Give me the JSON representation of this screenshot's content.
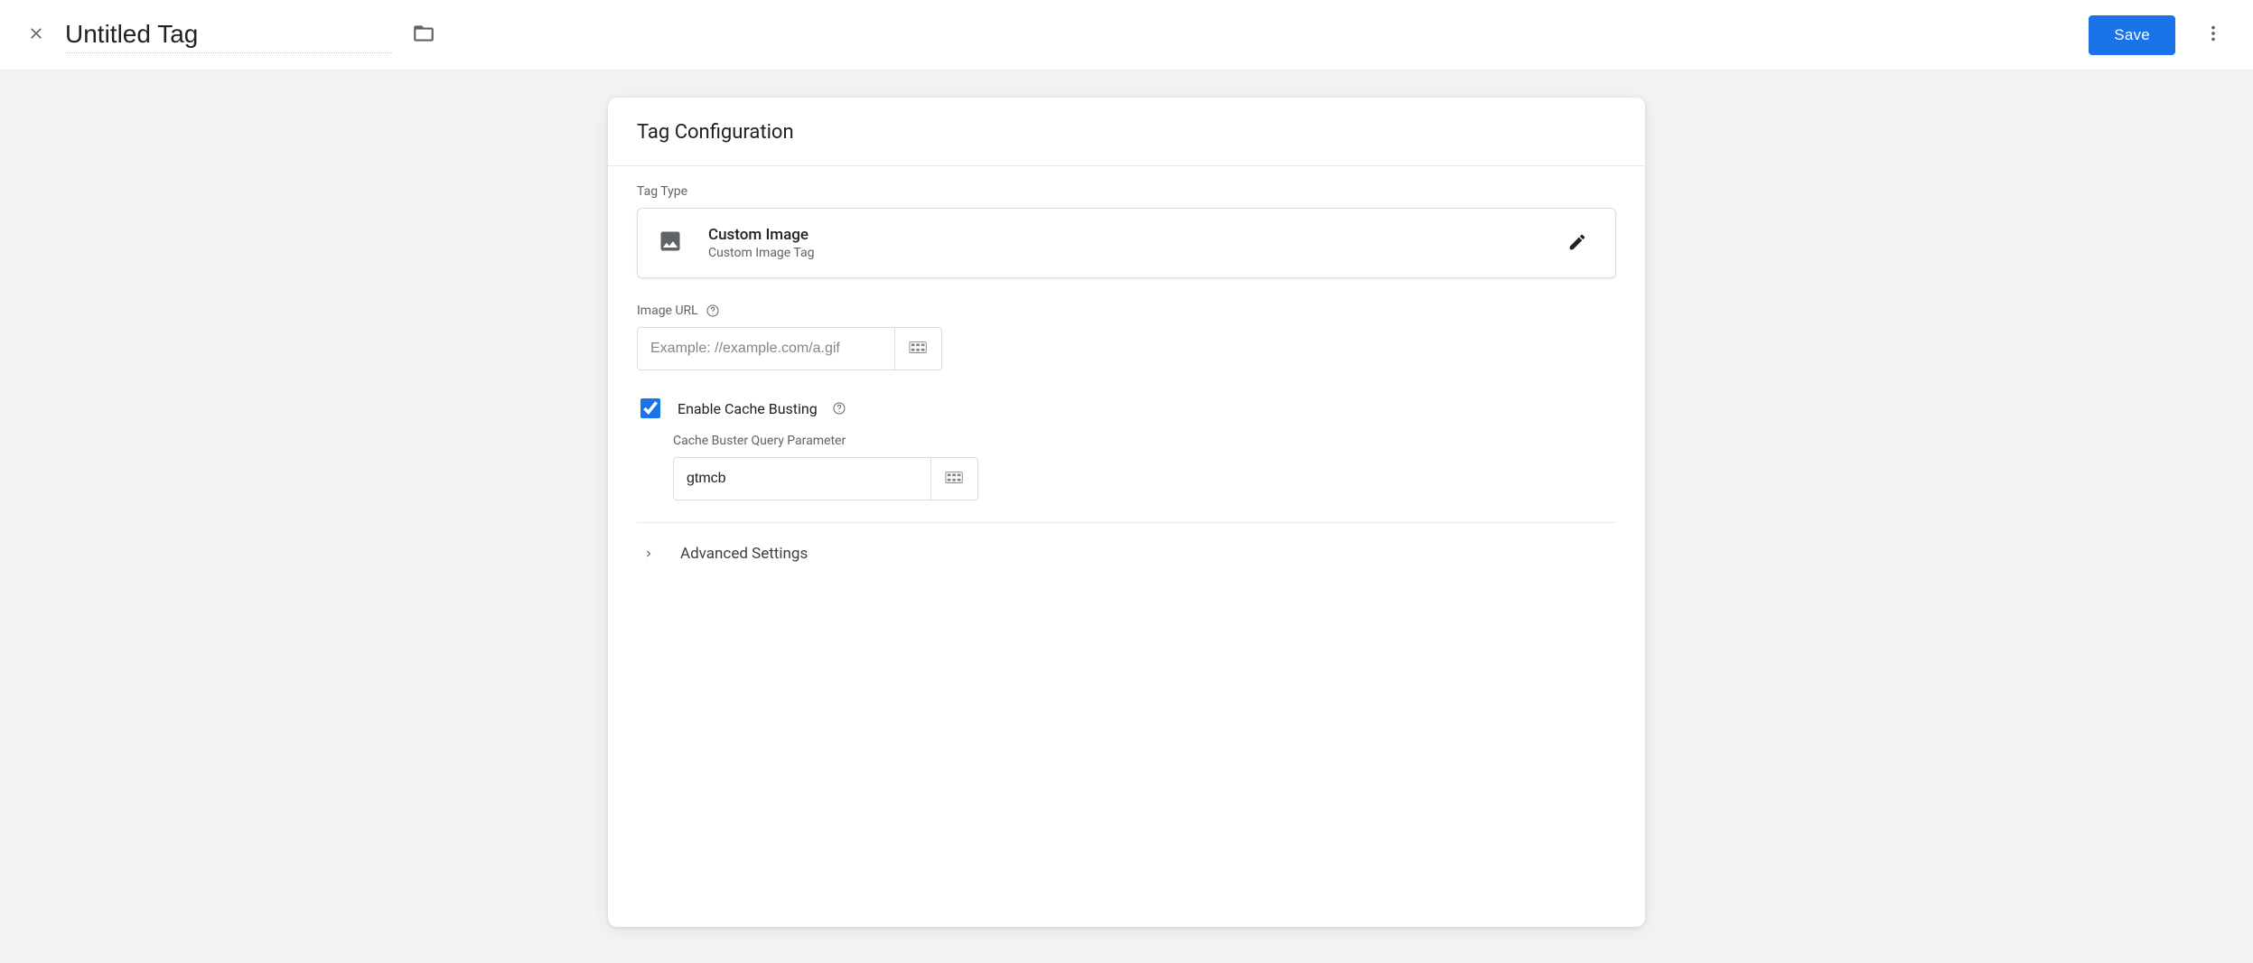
{
  "header": {
    "title": "Untitled Tag",
    "save_label": "Save"
  },
  "card": {
    "title": "Tag Configuration",
    "tag_type_label": "Tag Type",
    "tag_type": {
      "name": "Custom Image",
      "subtitle": "Custom Image Tag"
    },
    "image_url": {
      "label": "Image URL",
      "placeholder": "Example: //example.com/a.gif",
      "value": ""
    },
    "cache_busting": {
      "checked": true,
      "label": "Enable Cache Busting",
      "param_label": "Cache Buster Query Parameter",
      "param_value": "gtmcb"
    },
    "advanced_label": "Advanced Settings"
  }
}
